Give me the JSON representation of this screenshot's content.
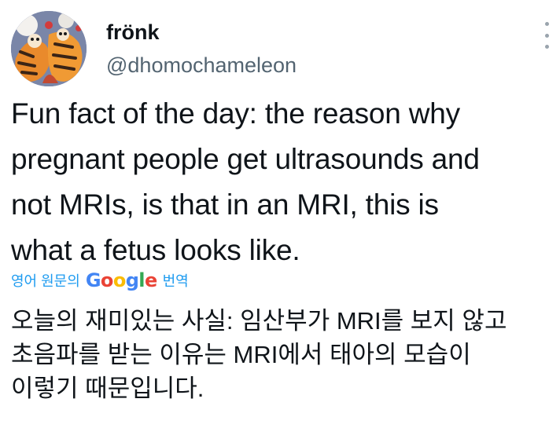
{
  "author": {
    "display_name": "frönk",
    "handle": "@dhomochameleon",
    "avatar_icon": "tiger-avatar"
  },
  "tweet": {
    "lines": [
      "Fun fact of the day: the reason why",
      "pregnant people get ultrasounds and",
      "not MRIs, is that in an MRI, this is",
      "what a fetus looks like."
    ]
  },
  "translation": {
    "prefix": "영어 원문의",
    "google_letters": [
      "G",
      "o",
      "o",
      "g",
      "l",
      "e"
    ],
    "google_colors": [
      "#4285F4",
      "#EA4335",
      "#FBBC05",
      "#4285F4",
      "#34A853",
      "#EA4335"
    ],
    "suffix": "번역",
    "lines": [
      "오늘의 재미있는 사실: 임산부가 MRI를 보지 않고",
      "초음파를 받는 이유는 MRI에서 태아의 모습이",
      "이렇기 때문입니다."
    ]
  },
  "colors": {
    "link": "#1d9bf0",
    "secondary_text": "#536471",
    "primary_text": "#0f1419"
  }
}
